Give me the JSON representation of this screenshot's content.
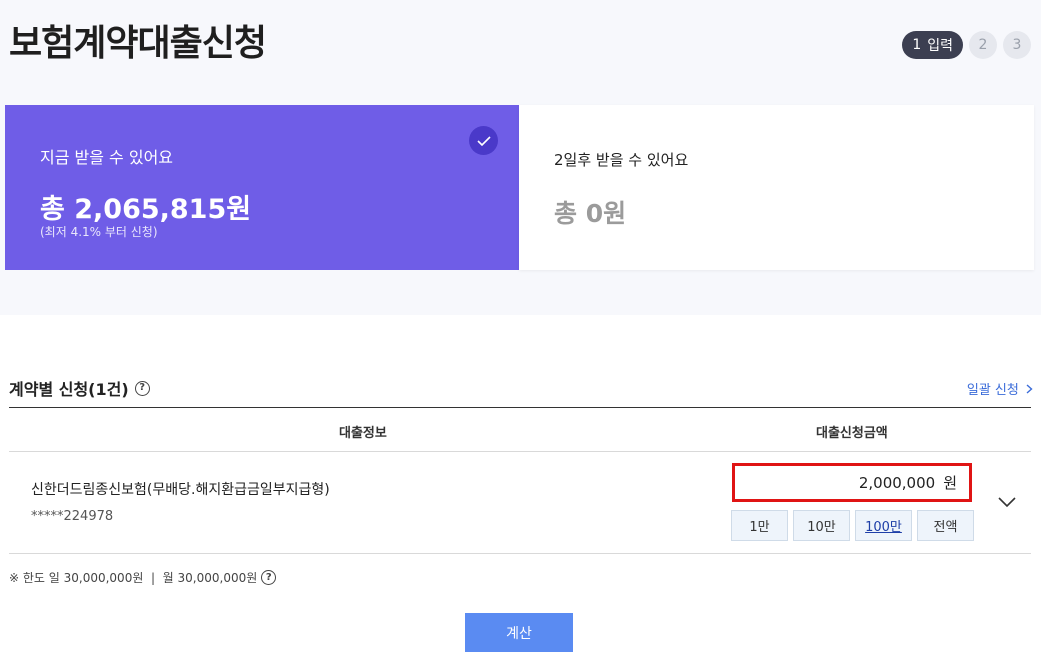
{
  "header": {
    "title": "보험계약대출신청",
    "steps": [
      {
        "num": "1",
        "label": "입력",
        "active": true
      },
      {
        "num": "2"
      },
      {
        "num": "3"
      }
    ]
  },
  "cards": {
    "now": {
      "subtitle": "지금 받을 수 있어요",
      "amount": "총 2,065,815원",
      "note": "(최저 4.1% 부터 신청)"
    },
    "later": {
      "subtitle": "2일후 받을 수 있어요",
      "amount": "총 0원"
    }
  },
  "section": {
    "title": "계약별 신청(1건)",
    "help": "?",
    "bulk_link": "일괄 신청",
    "columns": [
      "대출정보",
      "대출신청금액"
    ],
    "rows": [
      {
        "product": "신한더드림종신보험(무배당.해지환급금일부지급형)",
        "policy": "*****224978",
        "amount": "2,000,000",
        "unit": "원",
        "quick_buttons": [
          "1만",
          "10만",
          "100만",
          "전액"
        ],
        "selected_quick": "100만"
      }
    ]
  },
  "limit_note": "※ 한도 일 30,000,000원  |  월 30,000,000원",
  "calc_button": "계산",
  "colors": {
    "accent_card": "#6f5de7",
    "highlight_border": "#e01414",
    "primary_button": "#5a8bf2",
    "link": "#3b6cd9"
  }
}
